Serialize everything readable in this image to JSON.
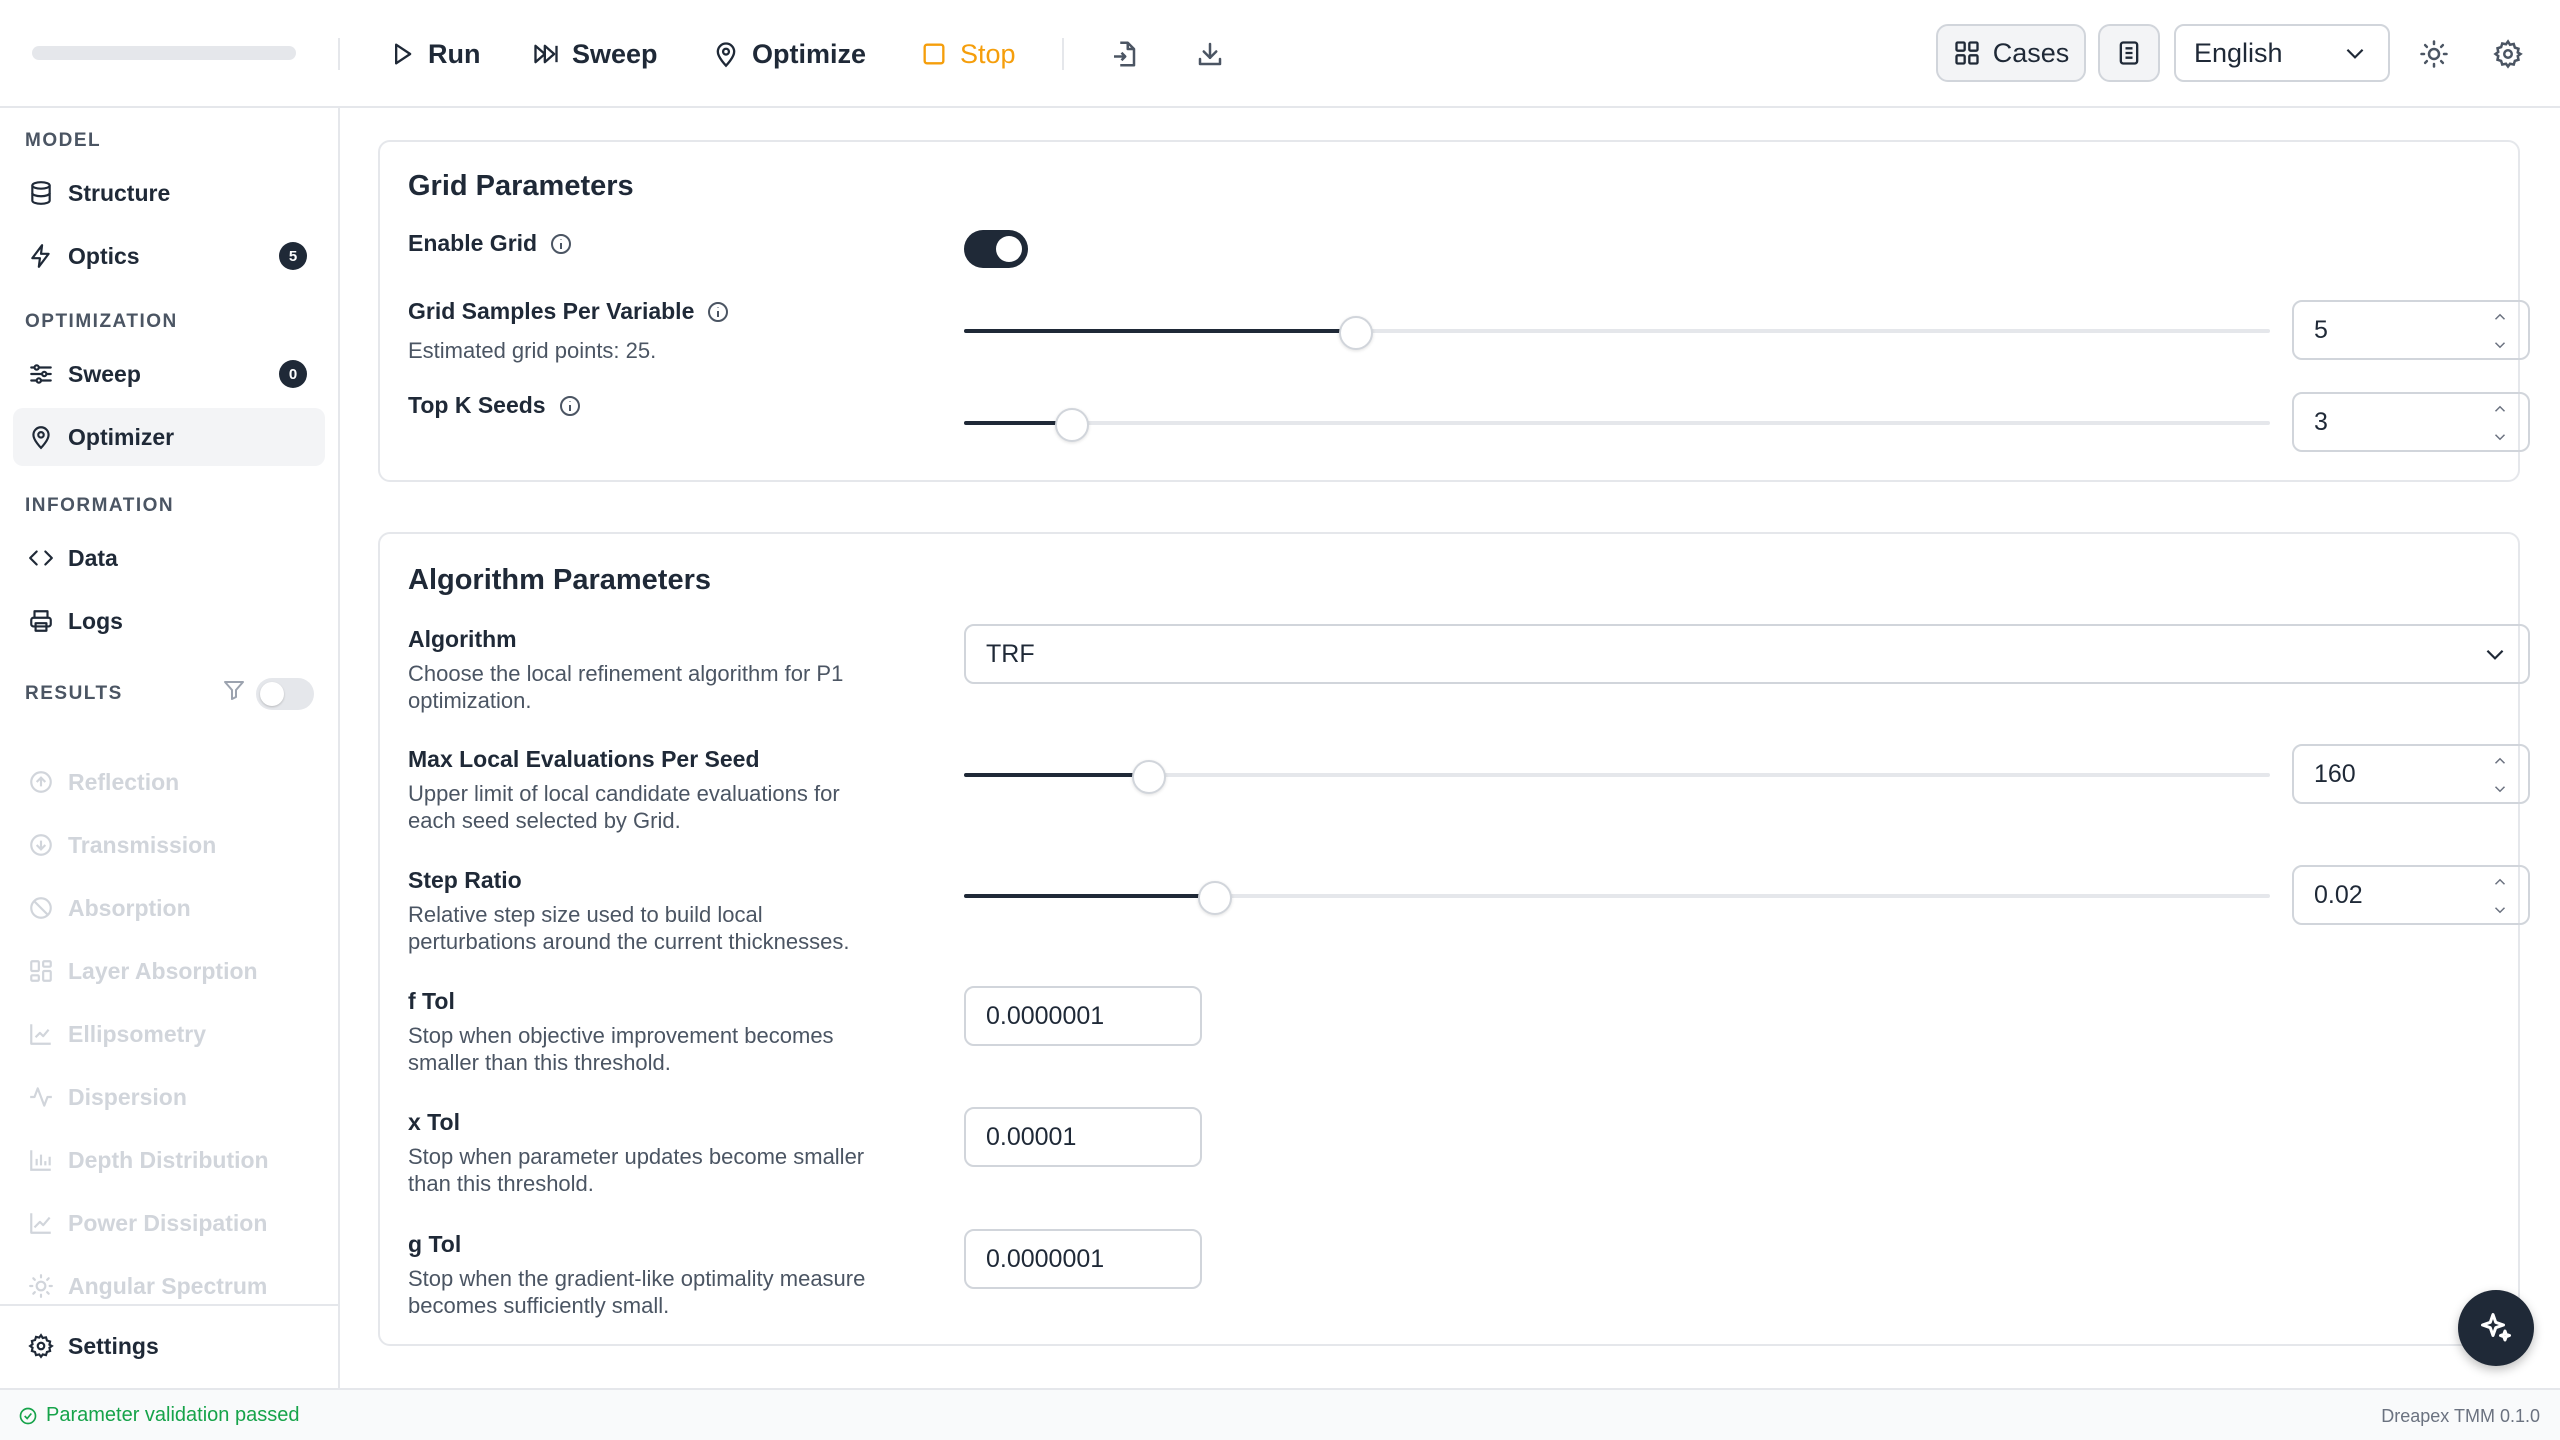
{
  "toolbar": {
    "run_label": "Run",
    "sweep_label": "Sweep",
    "optimize_label": "Optimize",
    "stop_label": "Stop",
    "cases_label": "Cases",
    "language": "English"
  },
  "sidebar": {
    "model_title": "MODEL",
    "optimization_title": "OPTIMIZATION",
    "information_title": "INFORMATION",
    "results_title": "RESULTS",
    "structure": "Structure",
    "optics": "Optics",
    "optics_badge": "5",
    "sweep": "Sweep",
    "sweep_badge": "0",
    "optimizer": "Optimizer",
    "data": "Data",
    "logs": "Logs",
    "results": [
      "Reflection",
      "Transmission",
      "Absorption",
      "Layer Absorption",
      "Ellipsometry",
      "Dispersion",
      "Depth Distribution",
      "Power Dissipation",
      "Angular Spectrum"
    ],
    "results_filter_enabled": false,
    "settings": "Settings"
  },
  "grid": {
    "title": "Grid Parameters",
    "enable_label": "Enable Grid",
    "enabled": true,
    "samples_label": "Grid Samples Per Variable",
    "samples_desc": "Estimated grid points: 25.",
    "samples_value": "5",
    "samples_fraction": 0.3,
    "topk_label": "Top K Seeds",
    "topk_value": "3",
    "topk_fraction": 0.083
  },
  "algorithm": {
    "title": "Algorithm Parameters",
    "algo_label": "Algorithm",
    "algo_desc": "Choose the local refinement algorithm for P1 optimization.",
    "algo_value": "TRF",
    "maxeval_label": "Max Local Evaluations Per Seed",
    "maxeval_desc": "Upper limit of local candidate evaluations for each seed selected by Grid.",
    "maxeval_value": "160",
    "maxeval_fraction": 0.142,
    "step_label": "Step Ratio",
    "step_desc": "Relative step size used to build local perturbations around the current thicknesses.",
    "step_value": "0.02",
    "step_fraction": 0.192,
    "ftol_label": "f Tol",
    "ftol_desc": "Stop when objective improvement becomes smaller than this threshold.",
    "ftol_value": "0.0000001",
    "xtol_label": "x Tol",
    "xtol_desc": "Stop when parameter updates become smaller than this threshold.",
    "xtol_value": "0.00001",
    "gtol_label": "g Tol",
    "gtol_desc": "Stop when the gradient-like optimality measure becomes sufficiently small.",
    "gtol_value": "0.0000001"
  },
  "status": {
    "message": "Parameter validation passed",
    "version": "Dreapex TMM 0.1.0"
  },
  "colors": {
    "accent": "#1f2937",
    "stop": "#f59e0b",
    "success": "#16a34a",
    "border": "#e5e7eb"
  }
}
